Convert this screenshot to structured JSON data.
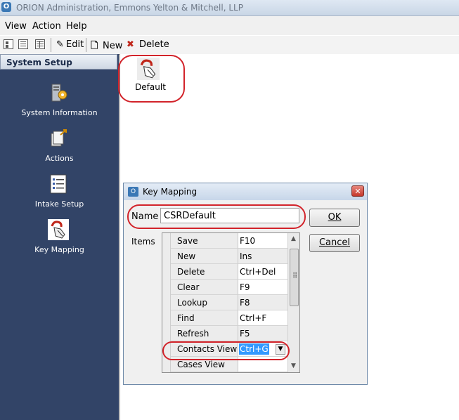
{
  "window": {
    "title": "ORION Administration, Emmons Yelton & Mitchell, LLP"
  },
  "menu": [
    "View",
    "Action",
    "Help"
  ],
  "toolbar": {
    "edit_label": "Edit",
    "new_label": "New",
    "delete_label": "Delete"
  },
  "sidebar": {
    "header": "System Setup",
    "items": [
      {
        "label": "System Information",
        "icon": "server-gear-icon"
      },
      {
        "label": "Actions",
        "icon": "actions-icon"
      },
      {
        "label": "Intake Setup",
        "icon": "checklist-icon"
      },
      {
        "label": "Key Mapping",
        "icon": "hand-key-icon"
      }
    ]
  },
  "content": {
    "items": [
      {
        "label": "Default",
        "icon": "hand-key-icon"
      }
    ]
  },
  "dialog": {
    "title": "Key Mapping",
    "name_label": "Name",
    "name_value": "CSRDefault",
    "items_label": "Items",
    "ok_label": "OK",
    "cancel_label": "Cancel",
    "rows": [
      {
        "action": "Save",
        "key": "F10"
      },
      {
        "action": "New",
        "key": "Ins"
      },
      {
        "action": "Delete",
        "key": "Ctrl+Del"
      },
      {
        "action": "Clear",
        "key": "F9"
      },
      {
        "action": "Lookup",
        "key": "F8"
      },
      {
        "action": "Find",
        "key": "Ctrl+F"
      },
      {
        "action": "Refresh",
        "key": "F5"
      },
      {
        "action": "Contacts View",
        "key": "Ctrl+G"
      },
      {
        "action": "Cases View",
        "key": ""
      }
    ]
  },
  "colors": {
    "sidebar_bg": "#324467",
    "highlight": "#d2232a",
    "selection": "#3399ff"
  }
}
